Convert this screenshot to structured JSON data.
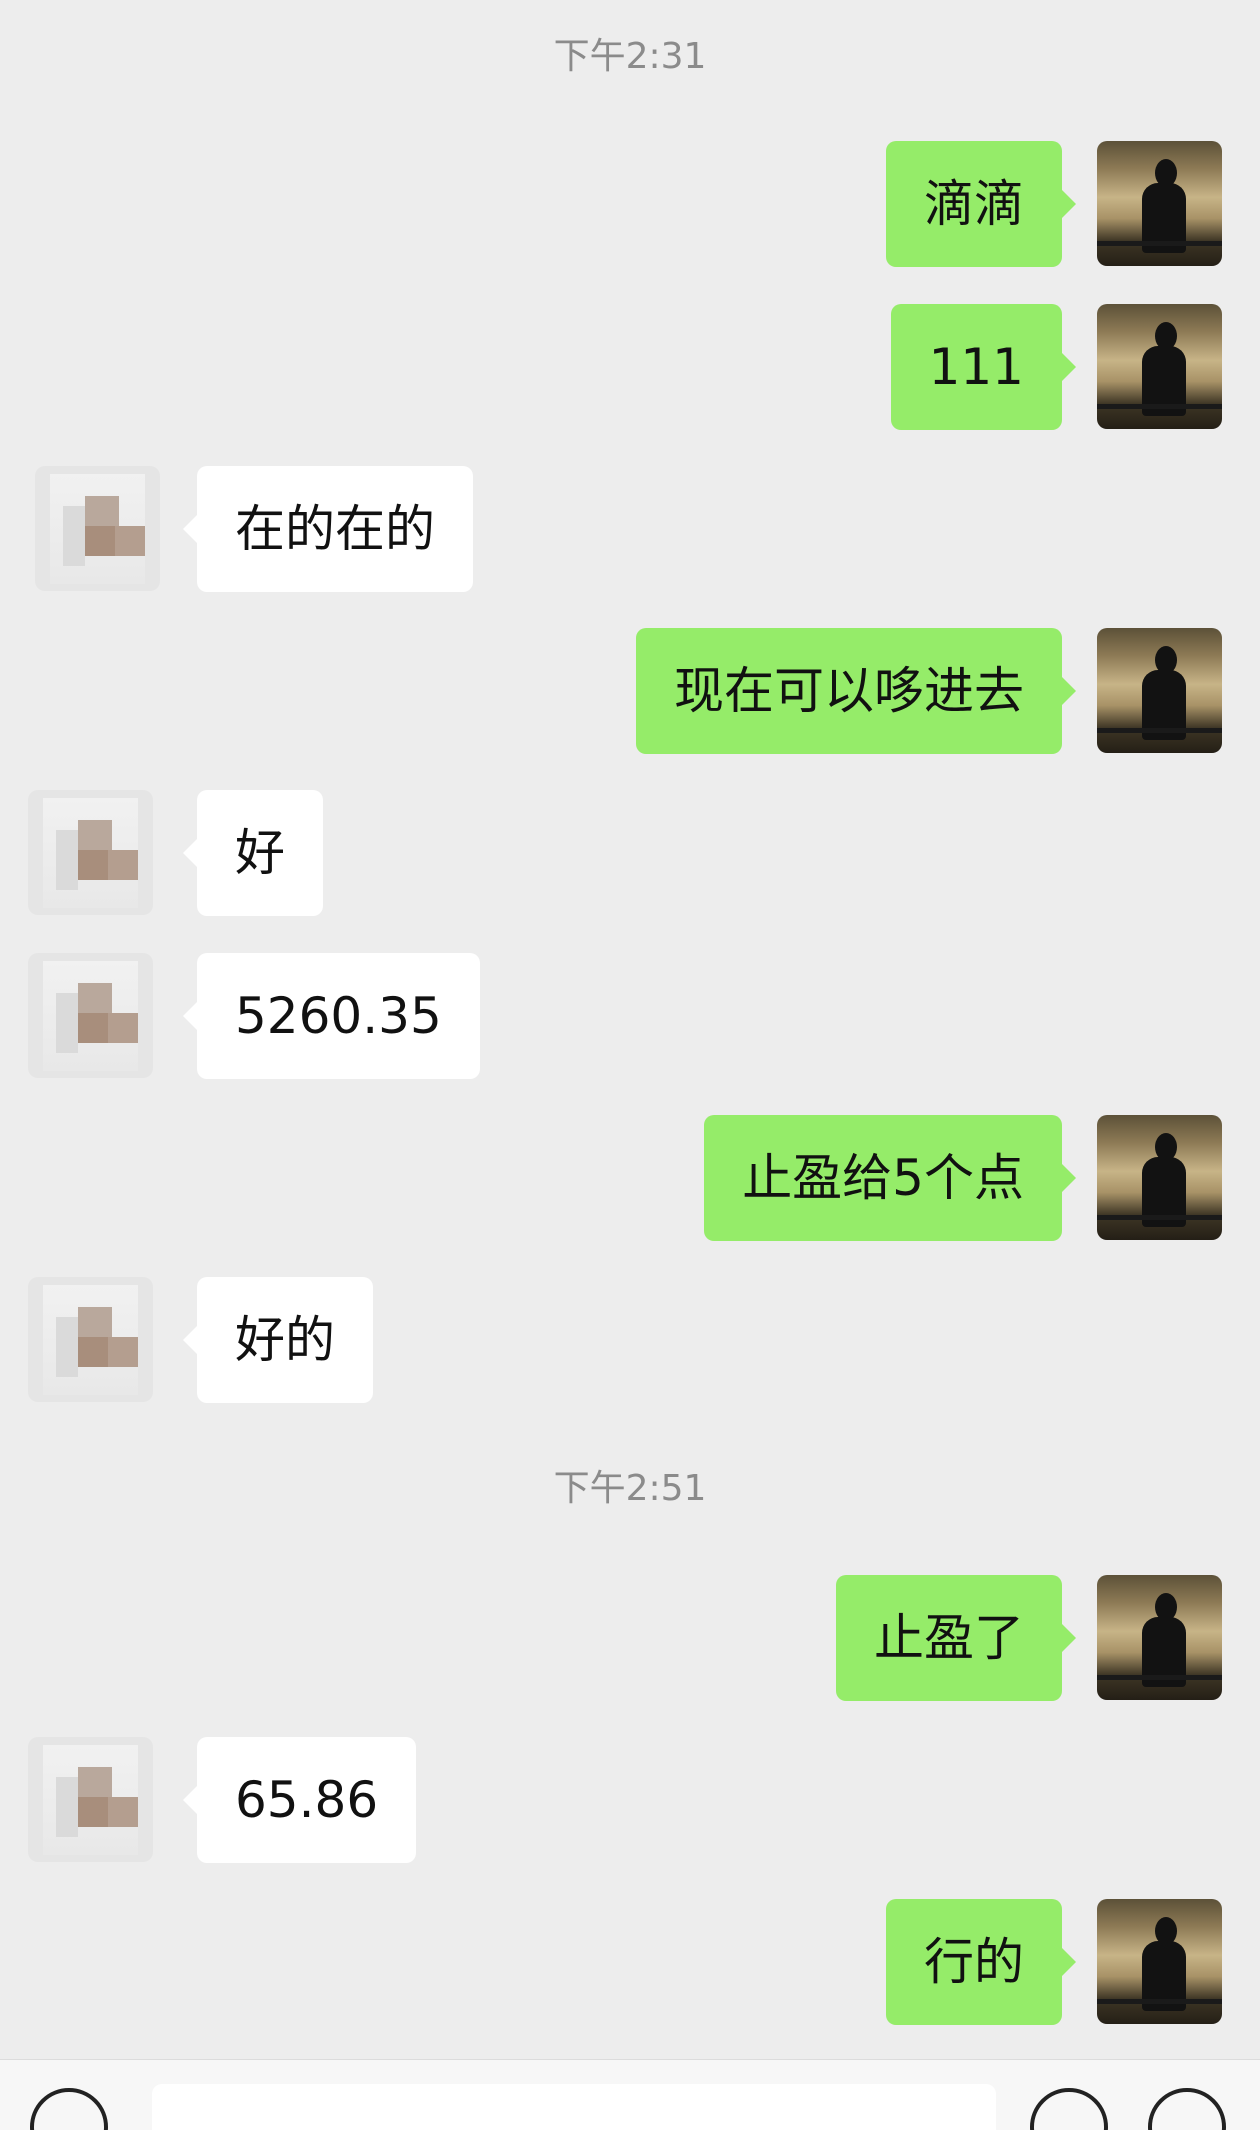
{
  "timestamps": [
    "下午2:31",
    "下午2:51"
  ],
  "messages": [
    {
      "sender": "me",
      "text": "滴滴"
    },
    {
      "sender": "me",
      "text": "111"
    },
    {
      "sender": "other",
      "text": "在的在的"
    },
    {
      "sender": "me",
      "text": "现在可以哆进去"
    },
    {
      "sender": "other",
      "text": "好"
    },
    {
      "sender": "other",
      "text": "5260.35"
    },
    {
      "sender": "me",
      "text": "止盈给5个点"
    },
    {
      "sender": "other",
      "text": "好的"
    },
    {
      "sender": "me",
      "text": "止盈了"
    },
    {
      "sender": "other",
      "text": "65.86"
    },
    {
      "sender": "me",
      "text": "行的"
    }
  ],
  "input_bar": {
    "left_icon": "voice-icon",
    "right_icons": [
      "emoji-icon",
      "plus-icon"
    ],
    "message_value": ""
  },
  "colors": {
    "background": "#ededed",
    "sent_bubble": "#95ec69",
    "received_bubble": "#ffffff",
    "timestamp_text": "#8b8b8b"
  }
}
